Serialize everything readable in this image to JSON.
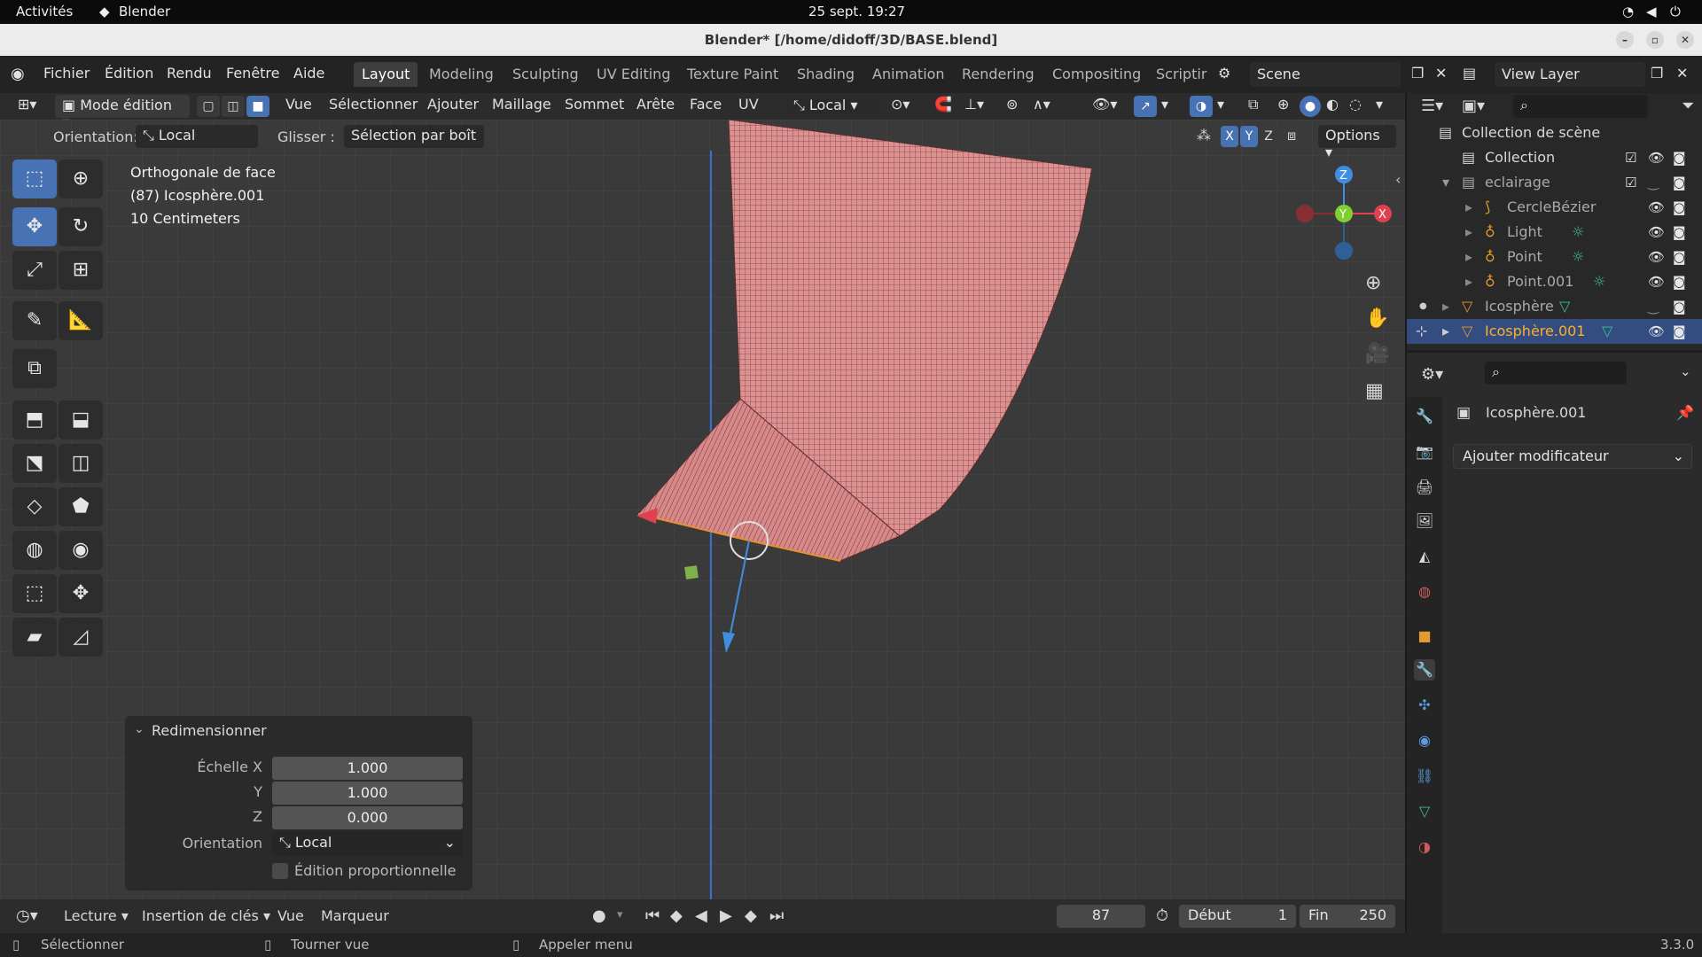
{
  "gnome": {
    "activities": "Activités",
    "app": "Blender",
    "clock": "25 sept.  19:27"
  },
  "window": {
    "title": "Blender* [/home/didoff/3D/BASE.blend]"
  },
  "menu": {
    "items": [
      "Fichier",
      "Édition",
      "Rendu",
      "Fenêtre",
      "Aide"
    ]
  },
  "workspaces": {
    "tabs": [
      "Layout",
      "Modeling",
      "Sculpting",
      "UV Editing",
      "Texture Paint",
      "Shading",
      "Animation",
      "Rendering",
      "Compositing",
      "Scriptir"
    ],
    "active": "Layout"
  },
  "scene": {
    "name": "Scene"
  },
  "view_layer": {
    "name": "View Layer"
  },
  "header3d": {
    "mode": "Mode édition",
    "menus": [
      "Vue",
      "Sélectionner",
      "Ajouter",
      "Maillage",
      "Sommet",
      "Arête",
      "Face",
      "UV"
    ],
    "transform_orientation": "Local"
  },
  "tool_settings": {
    "orientation_label": "Orientation:",
    "orientation_value": "Local",
    "drag_label": "Glisser :",
    "drag_value": "Sélection par boît",
    "axes": [
      "X",
      "Y",
      "Z"
    ],
    "options": "Options"
  },
  "viewport": {
    "view_name": "Orthogonale de face",
    "object_info": "(87) Icosphère.001",
    "scale_info": "10 Centimeters",
    "gizmo": {
      "z": "Z",
      "y": "Y",
      "x": "X"
    }
  },
  "redo_panel": {
    "title": "Redimensionner",
    "scale_x_label": "Échelle X",
    "scale_x": "1.000",
    "y_label": "Y",
    "y": "1.000",
    "z_label": "Z",
    "z": "0.000",
    "orientation_label": "Orientation",
    "orientation": "Local",
    "proportional_label": "Édition proportionnelle"
  },
  "timeline": {
    "menus": [
      "Lecture",
      "Insertion de clés",
      "Vue",
      "Marqueur"
    ],
    "current_frame": "87",
    "start_label": "Début",
    "start": "1",
    "end_label": "Fin",
    "end": "250"
  },
  "statusbar": {
    "select": "Sélectionner",
    "rotate": "Tourner vue",
    "menu": "Appeler menu",
    "version": "3.3.0"
  },
  "outliner": {
    "root": "Collection de scène",
    "rows": [
      {
        "name": "Collection",
        "indent": 1
      },
      {
        "name": "eclairage",
        "indent": 1
      },
      {
        "name": "CercleBézier",
        "indent": 2
      },
      {
        "name": "Light",
        "indent": 2
      },
      {
        "name": "Point",
        "indent": 2
      },
      {
        "name": "Point.001",
        "indent": 2
      },
      {
        "name": "Icosphère",
        "indent": 1
      },
      {
        "name": "Icosphère.001",
        "indent": 1
      }
    ]
  },
  "properties": {
    "object_name": "Icosphère.001",
    "add_modifier": "Ajouter modificateur"
  },
  "colors": {
    "accent": "#4772b3",
    "mesh": "#d98c8c",
    "selected_row": "#334d80",
    "axis_x": "#e0404f",
    "axis_y": "#7fcf2f",
    "axis_z": "#3f8ee0"
  }
}
